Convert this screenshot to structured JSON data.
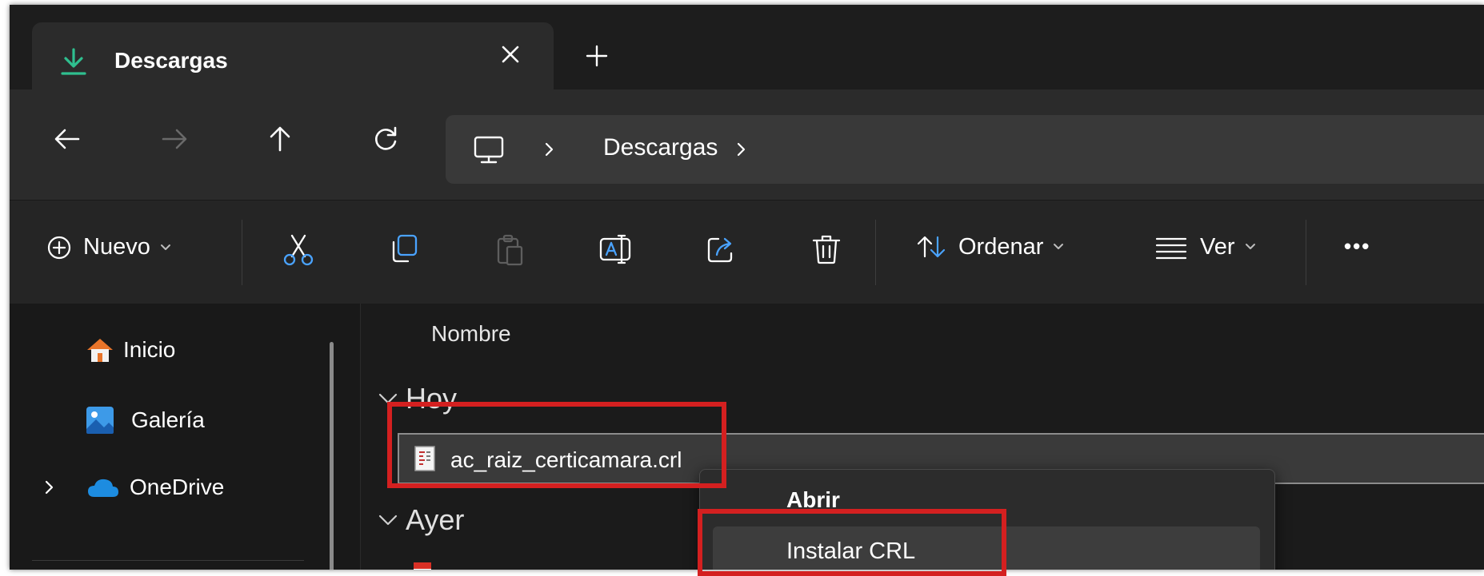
{
  "window": {
    "tab": {
      "title": "Descargas",
      "icon": "download-icon"
    },
    "new_tab_icon": "plus-icon"
  },
  "navigation": {
    "back_icon": "arrow-left-icon",
    "forward_icon": "arrow-right-icon",
    "up_icon": "arrow-up-icon",
    "refresh_icon": "refresh-icon",
    "breadcrumb": [
      "Descargas"
    ]
  },
  "toolbar": {
    "new_label": "Nuevo",
    "sort_label": "Ordenar",
    "view_label": "Ver",
    "more_label": "•••"
  },
  "sidebar": {
    "items": [
      {
        "label": "Inicio",
        "icon": "home-icon"
      },
      {
        "label": "Galería",
        "icon": "gallery-icon"
      },
      {
        "label": "OneDrive",
        "icon": "cloud-icon"
      }
    ]
  },
  "content": {
    "column_name": "Nombre",
    "groups": [
      {
        "label": "Hoy",
        "files": [
          "ac_raiz_certicamara.crl"
        ]
      },
      {
        "label": "Ayer"
      }
    ]
  },
  "context_menu": {
    "items": [
      "Abrir",
      "Instalar CRL"
    ]
  },
  "colors": {
    "accent": "#2fbf8f",
    "highlight_box": "#d42020",
    "onedrive": "#1d8ce0"
  }
}
